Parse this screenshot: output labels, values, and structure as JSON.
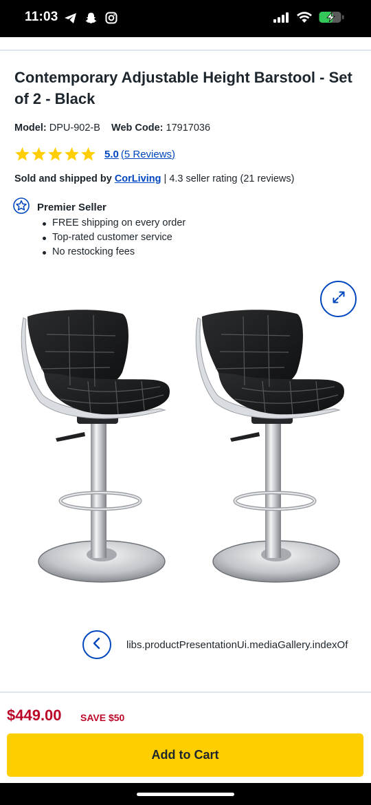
{
  "status_bar": {
    "time": "11:03",
    "left_icons": [
      "telegram-icon",
      "snapchat-icon",
      "instagram-icon"
    ],
    "right_icons": [
      "cellular-signal-icon",
      "wifi-icon",
      "battery-charging-icon"
    ]
  },
  "product": {
    "title": "Contemporary Adjustable Height Barstool - Set of 2 - Black",
    "model_label": "Model:",
    "model_value": "DPU-902-B",
    "webcode_label": "Web Code:",
    "webcode_value": "17917036",
    "rating_value": "5.0",
    "rating_stars": 5,
    "reviews_link": "(5 Reviews)",
    "star_color": "#ffce00"
  },
  "seller": {
    "prefix": "Sold and shipped by",
    "name": "CorLiving",
    "rating_text": " | 4.3 seller rating (21 reviews)",
    "badge_label": "Premier Seller",
    "perks": [
      "FREE shipping on every order",
      "Top-rated customer service",
      "No restocking fees"
    ]
  },
  "gallery": {
    "caption_key": "libs.productPresentationUi.mediaGallery.indexOf",
    "expand_icon": "expand-icon",
    "prev_icon": "chevron-left-icon"
  },
  "purchase": {
    "price": "$449.00",
    "save": "SAVE $50",
    "add_to_cart": "Add to Cart",
    "price_color": "#bb0628",
    "button_color": "#ffce00"
  },
  "colors": {
    "link_blue": "#0046be",
    "text_dark": "#1d252c"
  }
}
